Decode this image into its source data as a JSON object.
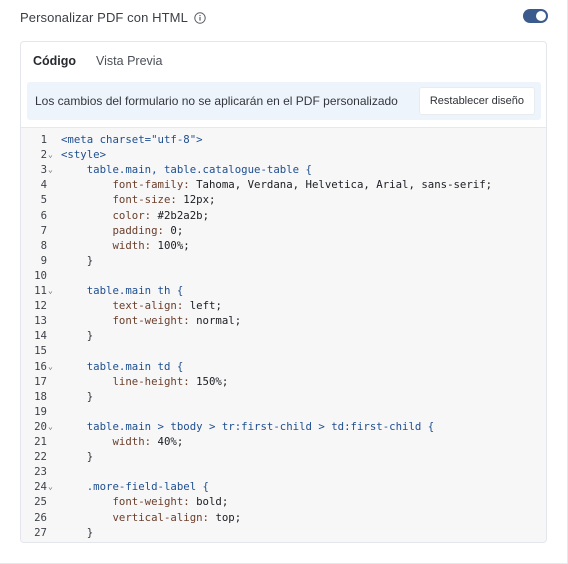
{
  "header": {
    "title": "Personalizar PDF con HTML",
    "toggle_on": true,
    "accent_color": "#3b5b8e"
  },
  "tabs": [
    {
      "label": "Código",
      "active": true
    },
    {
      "label": "Vista Previa",
      "active": false
    }
  ],
  "notice": {
    "text": "Los cambios del formulario no se aplicarán en el PDF personalizado",
    "button_label": "Restablecer diseño"
  },
  "editor": {
    "lines": [
      {
        "n": "1",
        "fold": false,
        "segs": [
          [
            "t-kw",
            "<meta charset=\"utf-8\">"
          ]
        ]
      },
      {
        "n": "2",
        "fold": true,
        "segs": [
          [
            "t-kw",
            "<style>"
          ]
        ]
      },
      {
        "n": "3",
        "fold": true,
        "segs": [
          [
            "t-sel",
            "    table.main, table.catalogue-table {"
          ]
        ]
      },
      {
        "n": "4",
        "fold": false,
        "segs": [
          [
            "t-prop",
            "        font-family: "
          ],
          [
            "t-val",
            "Tahoma, Verdana, Helvetica, Arial, sans-serif;"
          ]
        ]
      },
      {
        "n": "5",
        "fold": false,
        "segs": [
          [
            "t-prop",
            "        font-size: "
          ],
          [
            "t-val",
            "12px;"
          ]
        ]
      },
      {
        "n": "6",
        "fold": false,
        "segs": [
          [
            "t-prop",
            "        color: "
          ],
          [
            "t-val",
            "#2b2a2b;"
          ]
        ]
      },
      {
        "n": "7",
        "fold": false,
        "segs": [
          [
            "t-prop",
            "        padding: "
          ],
          [
            "t-val",
            "0;"
          ]
        ]
      },
      {
        "n": "8",
        "fold": false,
        "segs": [
          [
            "t-prop",
            "        width: "
          ],
          [
            "t-val",
            "100%;"
          ]
        ]
      },
      {
        "n": "9",
        "fold": false,
        "segs": [
          [
            "t-pun",
            "    }"
          ]
        ]
      },
      {
        "n": "10",
        "fold": false,
        "segs": [
          [
            "t-pun",
            ""
          ]
        ]
      },
      {
        "n": "11",
        "fold": true,
        "segs": [
          [
            "t-sel",
            "    table.main th {"
          ]
        ]
      },
      {
        "n": "12",
        "fold": false,
        "segs": [
          [
            "t-prop",
            "        text-align: "
          ],
          [
            "t-val",
            "left;"
          ]
        ]
      },
      {
        "n": "13",
        "fold": false,
        "segs": [
          [
            "t-prop",
            "        font-weight: "
          ],
          [
            "t-val",
            "normal;"
          ]
        ]
      },
      {
        "n": "14",
        "fold": false,
        "segs": [
          [
            "t-pun",
            "    }"
          ]
        ]
      },
      {
        "n": "15",
        "fold": false,
        "segs": [
          [
            "t-pun",
            ""
          ]
        ]
      },
      {
        "n": "16",
        "fold": true,
        "segs": [
          [
            "t-sel",
            "    table.main td {"
          ]
        ]
      },
      {
        "n": "17",
        "fold": false,
        "segs": [
          [
            "t-prop",
            "        line-height: "
          ],
          [
            "t-val",
            "150%;"
          ]
        ]
      },
      {
        "n": "18",
        "fold": false,
        "segs": [
          [
            "t-pun",
            "    }"
          ]
        ]
      },
      {
        "n": "19",
        "fold": false,
        "segs": [
          [
            "t-pun",
            ""
          ]
        ]
      },
      {
        "n": "20",
        "fold": true,
        "segs": [
          [
            "t-sel",
            "    table.main > tbody > tr:first-child > td:first-child {"
          ]
        ]
      },
      {
        "n": "21",
        "fold": false,
        "segs": [
          [
            "t-prop",
            "        width: "
          ],
          [
            "t-val",
            "40%;"
          ]
        ]
      },
      {
        "n": "22",
        "fold": false,
        "segs": [
          [
            "t-pun",
            "    }"
          ]
        ]
      },
      {
        "n": "23",
        "fold": false,
        "segs": [
          [
            "t-pun",
            ""
          ]
        ]
      },
      {
        "n": "24",
        "fold": true,
        "segs": [
          [
            "t-sel",
            "    .more-field-label {"
          ]
        ]
      },
      {
        "n": "25",
        "fold": false,
        "segs": [
          [
            "t-prop",
            "        font-weight: "
          ],
          [
            "t-val",
            "bold;"
          ]
        ]
      },
      {
        "n": "26",
        "fold": false,
        "segs": [
          [
            "t-prop",
            "        vertical-align: "
          ],
          [
            "t-val",
            "top;"
          ]
        ]
      },
      {
        "n": "27",
        "fold": false,
        "segs": [
          [
            "t-pun",
            "    }"
          ]
        ]
      }
    ]
  }
}
